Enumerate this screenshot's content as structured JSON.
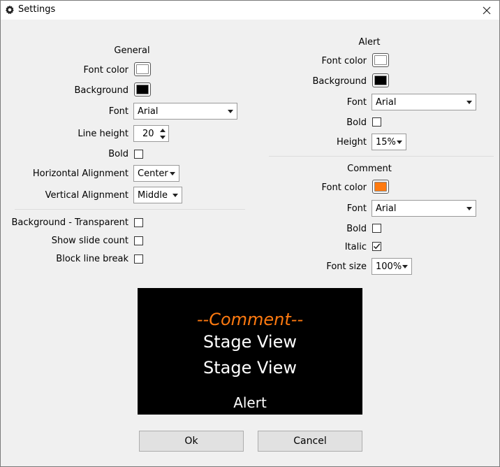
{
  "window": {
    "title": "Settings"
  },
  "general": {
    "heading": "General",
    "font_color_label": "Font color",
    "font_color": "#ffffff",
    "background_label": "Background",
    "background_color": "#000000",
    "font_label": "Font",
    "font_value": "Arial",
    "line_height_label": "Line height",
    "line_height_value": "20",
    "bold_label": "Bold",
    "bold_checked": false,
    "h_align_label": "Horizontal Alignment",
    "h_align_value": "Center",
    "v_align_label": "Vertical Alignment",
    "v_align_value": "Middle",
    "bg_transparent_label": "Background - Transparent",
    "show_slide_count_label": "Show slide count",
    "block_line_break_label": "Block line break"
  },
  "alert": {
    "heading": "Alert",
    "font_color_label": "Font color",
    "font_color": "#ffffff",
    "background_label": "Background",
    "background_color": "#000000",
    "font_label": "Font",
    "font_value": "Arial",
    "bold_label": "Bold",
    "height_label": "Height",
    "height_value": "15%"
  },
  "comment": {
    "heading": "Comment",
    "font_color_label": "Font color",
    "font_color": "#ff7a10",
    "font_label": "Font",
    "font_value": "Arial",
    "bold_label": "Bold",
    "italic_label": "Italic",
    "italic_checked": true,
    "font_size_label": "Font size",
    "font_size_value": "100%"
  },
  "preview": {
    "comment_text": "--Comment--",
    "comment_color": "#ff7a10",
    "stage_line_1": "Stage View",
    "stage_line_2": "Stage View",
    "alert_text": "Alert"
  },
  "buttons": {
    "ok": "Ok",
    "cancel": "Cancel"
  }
}
